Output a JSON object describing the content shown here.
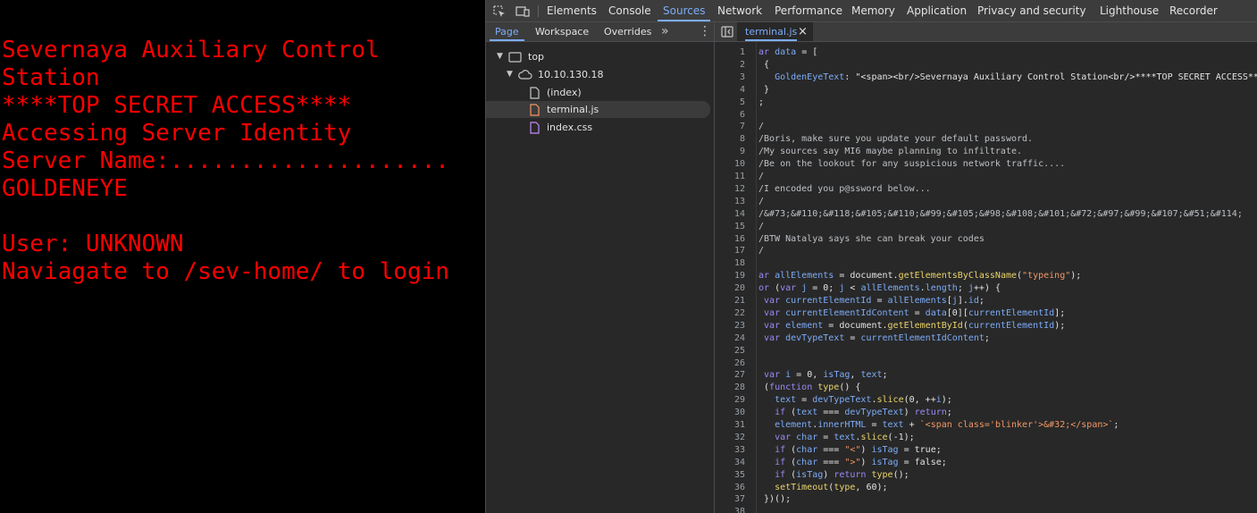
{
  "terminal": {
    "lines": [
      "Severnaya Auxiliary Control",
      "Station",
      "****TOP SECRET ACCESS****",
      "Accessing Server Identity",
      "Server Name:....................",
      "GOLDENEYE",
      "",
      "User: UNKNOWN",
      "Naviagate to /sev-home/ to login"
    ],
    "text_color": "#ff0000"
  },
  "devtools": {
    "main_tabs": [
      "Elements",
      "Console",
      "Sources",
      "Network",
      "Performance",
      "Memory",
      "Application",
      "Privacy and security",
      "Lighthouse",
      "Recorder"
    ],
    "active_main_tab": "Sources",
    "accent_color": "#7cacf8",
    "navigator": {
      "tabs": [
        "Page",
        "Workspace",
        "Overrides"
      ],
      "active_tab": "Page",
      "more_icon": "chevron-double-right-icon",
      "menu_icon": "kebab-menu-icon",
      "tree": [
        {
          "label": "top",
          "icon": "frame-icon"
        },
        {
          "label": "10.10.130.18",
          "icon": "cloud-icon"
        },
        {
          "label": "(index)",
          "icon": "document-icon"
        },
        {
          "label": "terminal.js",
          "icon": "js-file-icon",
          "selected": true
        },
        {
          "label": "index.css",
          "icon": "css-file-icon"
        }
      ]
    },
    "editor": {
      "open_file": "terminal.js",
      "close_icon": "close-icon",
      "lines": [
        {
          "n": "1",
          "t": "ar data = ["
        },
        {
          "n": "2",
          "t": " {"
        },
        {
          "n": "3",
          "t": "   GoldenEyeText: \"<span><br/>Severnaya Auxiliary Control Station<br/>****TOP SECRET ACCESS****"
        },
        {
          "n": "4",
          "t": " }"
        },
        {
          "n": "5",
          "t": ";"
        },
        {
          "n": "6",
          "t": ""
        },
        {
          "n": "7",
          "t": "/"
        },
        {
          "n": "8",
          "t": "/Boris, make sure you update your default password."
        },
        {
          "n": "9",
          "t": "/My sources say MI6 maybe planning to infiltrate."
        },
        {
          "n": "10",
          "t": "/Be on the lookout for any suspicious network traffic...."
        },
        {
          "n": "11",
          "t": "/"
        },
        {
          "n": "12",
          "t": "/I encoded you p@ssword below..."
        },
        {
          "n": "13",
          "t": "/"
        },
        {
          "n": "14",
          "t": "/&#73;&#110;&#118;&#105;&#110;&#99;&#105;&#98;&#108;&#101;&#72;&#97;&#99;&#107;&#51;&#114;"
        },
        {
          "n": "15",
          "t": "/"
        },
        {
          "n": "16",
          "t": "/BTW Natalya says she can break your codes"
        },
        {
          "n": "17",
          "t": "/"
        },
        {
          "n": "18",
          "t": ""
        },
        {
          "n": "19",
          "t": "ar allElements = document.getElementsByClassName(\"typeing\");"
        },
        {
          "n": "20",
          "t": "or (var j = 0; j < allElements.length; j++) {"
        },
        {
          "n": "21",
          "t": " var currentElementId = allElements[j].id;"
        },
        {
          "n": "22",
          "t": " var currentElementIdContent = data[0][currentElementId];"
        },
        {
          "n": "23",
          "t": " var element = document.getElementById(currentElementId);"
        },
        {
          "n": "24",
          "t": " var devTypeText = currentElementIdContent;"
        },
        {
          "n": "25",
          "t": ""
        },
        {
          "n": "26",
          "t": ""
        },
        {
          "n": "27",
          "t": " var i = 0, isTag, text;"
        },
        {
          "n": "28",
          "t": " (function type() {"
        },
        {
          "n": "29",
          "t": "   text = devTypeText.slice(0, ++i);"
        },
        {
          "n": "30",
          "t": "   if (text === devTypeText) return;"
        },
        {
          "n": "31",
          "t": "   element.innerHTML = text + `<span class='blinker'>&#32;</span>`;"
        },
        {
          "n": "32",
          "t": "   var char = text.slice(-1);"
        },
        {
          "n": "33",
          "t": "   if (char === \"<\") isTag = true;"
        },
        {
          "n": "34",
          "t": "   if (char === \">\") isTag = false;"
        },
        {
          "n": "35",
          "t": "   if (isTag) return type();"
        },
        {
          "n": "36",
          "t": "   setTimeout(type, 60);"
        },
        {
          "n": "37",
          "t": " })();"
        },
        {
          "n": "38",
          "t": ""
        }
      ]
    }
  }
}
